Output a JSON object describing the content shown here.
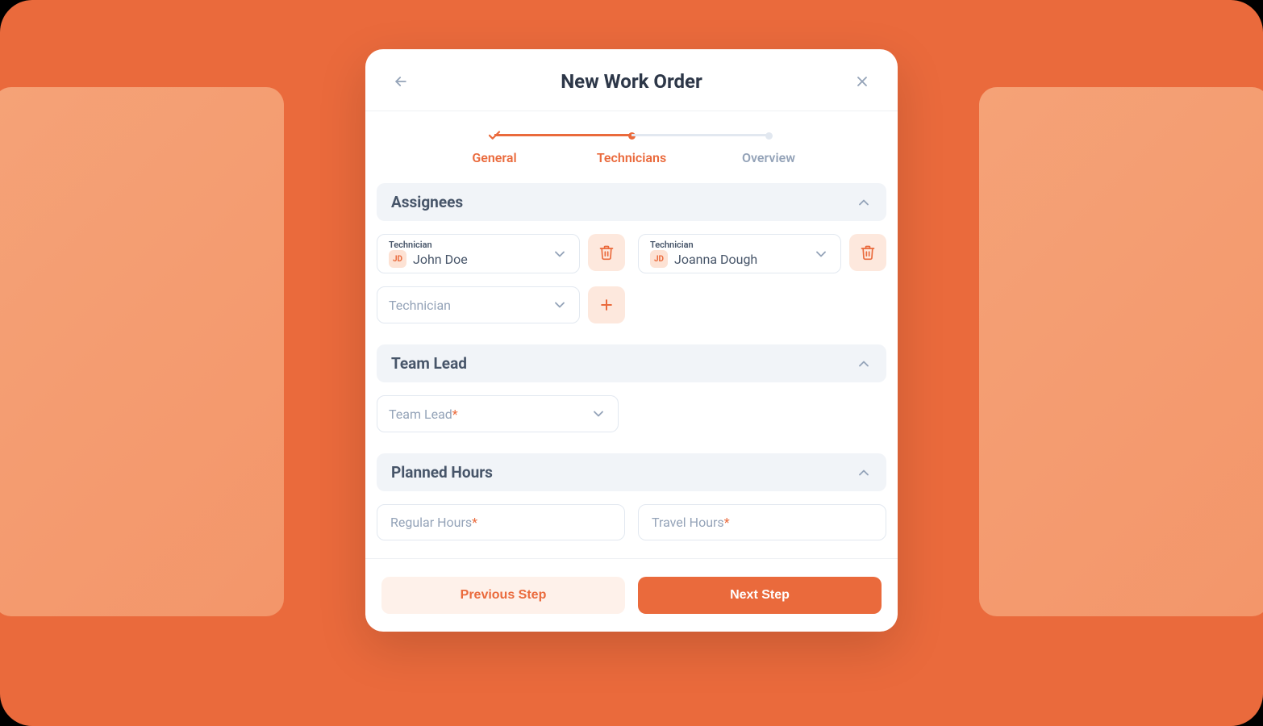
{
  "colors": {
    "accent": "#ea6a3c",
    "muted": "#94a3b8",
    "heading": "#2d3748"
  },
  "modal": {
    "title": "New Work Order",
    "stepper": {
      "steps": [
        {
          "label": "General",
          "state": "done"
        },
        {
          "label": "Technicians",
          "state": "active"
        },
        {
          "label": "Overview",
          "state": "inactive"
        }
      ]
    },
    "sections": {
      "assignees": {
        "title": "Assignees",
        "field_label": "Technician",
        "rows": [
          {
            "initials": "JD",
            "name": "John Doe"
          },
          {
            "initials": "JD",
            "name": "Joanna Dough"
          }
        ],
        "empty_placeholder": "Technician"
      },
      "team_lead": {
        "title": "Team Lead",
        "placeholder": "Team Lead",
        "required": true
      },
      "planned_hours": {
        "title": "Planned Hours",
        "regular": {
          "placeholder": "Regular Hours",
          "required": true
        },
        "travel": {
          "placeholder": "Travel Hours",
          "required": true
        }
      }
    },
    "footer": {
      "prev": "Previous Step",
      "next": "Next Step"
    }
  },
  "icons": {
    "back": "arrow-left-icon",
    "close": "close-icon",
    "check": "check-icon",
    "chevron_down": "chevron-down-icon",
    "chevron_up": "chevron-up-icon",
    "trash": "trash-icon",
    "plus": "plus-icon"
  }
}
